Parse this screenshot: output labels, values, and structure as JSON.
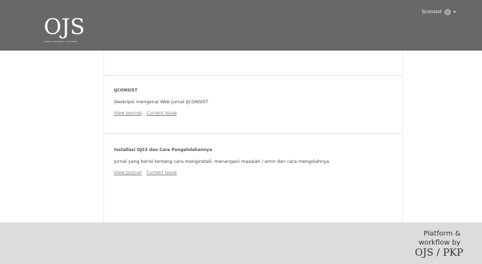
{
  "header": {
    "logo_main": "OJS",
    "logo_sub": "Open Journal Systems",
    "user_name": "ljconsist",
    "user_caret": "▾"
  },
  "journals": [
    {
      "title": "IJCONSIST",
      "description": "Deskripsi mengenai Web Jurnal IJCONSIST",
      "view_label": "View Journal",
      "current_label": "Current Issue"
    },
    {
      "title": "Installasi OJS3 dan Cara Pengelolahannya",
      "description": "Jurnal yang berisi tentang cara menginstall, menangani masalah / error dan cara mengolahnya",
      "view_label": "View Journal",
      "current_label": "Current Issue"
    }
  ],
  "footer": {
    "platform_line1": "Platform &",
    "platform_line2": "workflow by",
    "pkp_logo": "OJS / PKP"
  }
}
